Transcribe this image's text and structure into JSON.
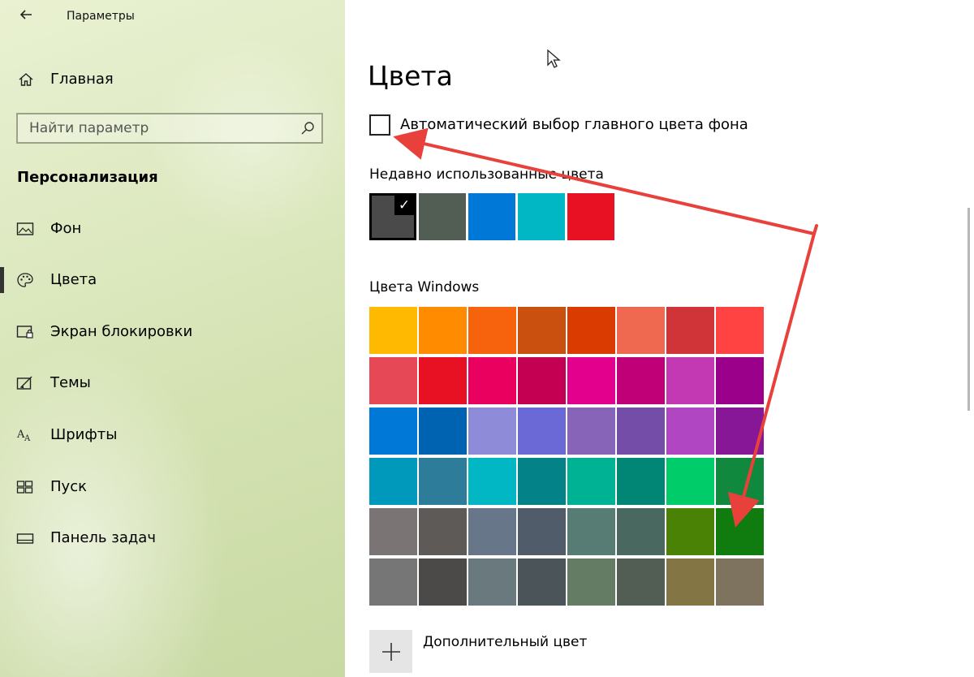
{
  "window": {
    "title": "Параметры"
  },
  "sidebar": {
    "home_label": "Главная",
    "search_placeholder": "Найти параметр",
    "section_title": "Персонализация",
    "items": [
      {
        "label": "Фон",
        "icon": "picture-icon",
        "active": false
      },
      {
        "label": "Цвета",
        "icon": "palette-icon",
        "active": true
      },
      {
        "label": "Экран блокировки",
        "icon": "lock-screen-icon",
        "active": false
      },
      {
        "label": "Темы",
        "icon": "themes-icon",
        "active": false
      },
      {
        "label": "Шрифты",
        "icon": "fonts-icon",
        "active": false
      },
      {
        "label": "Пуск",
        "icon": "start-icon",
        "active": false
      },
      {
        "label": "Панель задач",
        "icon": "taskbar-icon",
        "active": false
      }
    ]
  },
  "main": {
    "title": "Цвета",
    "auto_color_label": "Автоматический выбор главного цвета фона",
    "auto_color_checked": false,
    "recent_label": "Недавно использованные цвета",
    "recent_colors": [
      "#4a4a4a",
      "#525e54",
      "#0078d7",
      "#00b7c3",
      "#e81123"
    ],
    "recent_selected_index": 0,
    "windows_label": "Цвета Windows",
    "windows_colors": [
      [
        "#ffb900",
        "#ff8c00",
        "#f7630c",
        "#ca5010",
        "#da3b01",
        "#ef6950",
        "#d13438",
        "#ff4343"
      ],
      [
        "#e74856",
        "#e81123",
        "#ea005e",
        "#c30052",
        "#e3008c",
        "#bf0077",
        "#c239b3",
        "#9a0089"
      ],
      [
        "#0078d7",
        "#0063b1",
        "#8e8cd8",
        "#6b69d6",
        "#8764b8",
        "#744da9",
        "#b146c2",
        "#881798"
      ],
      [
        "#0099bc",
        "#2d7d9a",
        "#00b7c3",
        "#038387",
        "#00b294",
        "#018574",
        "#00cc6a",
        "#10893e"
      ],
      [
        "#7a7574",
        "#5d5a58",
        "#68768a",
        "#515c6b",
        "#567c73",
        "#486860",
        "#498205",
        "#107c10"
      ],
      [
        "#767676",
        "#4c4a48",
        "#69797e",
        "#4a5459",
        "#647c64",
        "#525e54",
        "#847545",
        "#7e735f"
      ]
    ],
    "add_color_label": "Дополнительный цвет"
  },
  "colors": {
    "accent": "#0078d7",
    "annotation_arrow": "#e8413c"
  }
}
